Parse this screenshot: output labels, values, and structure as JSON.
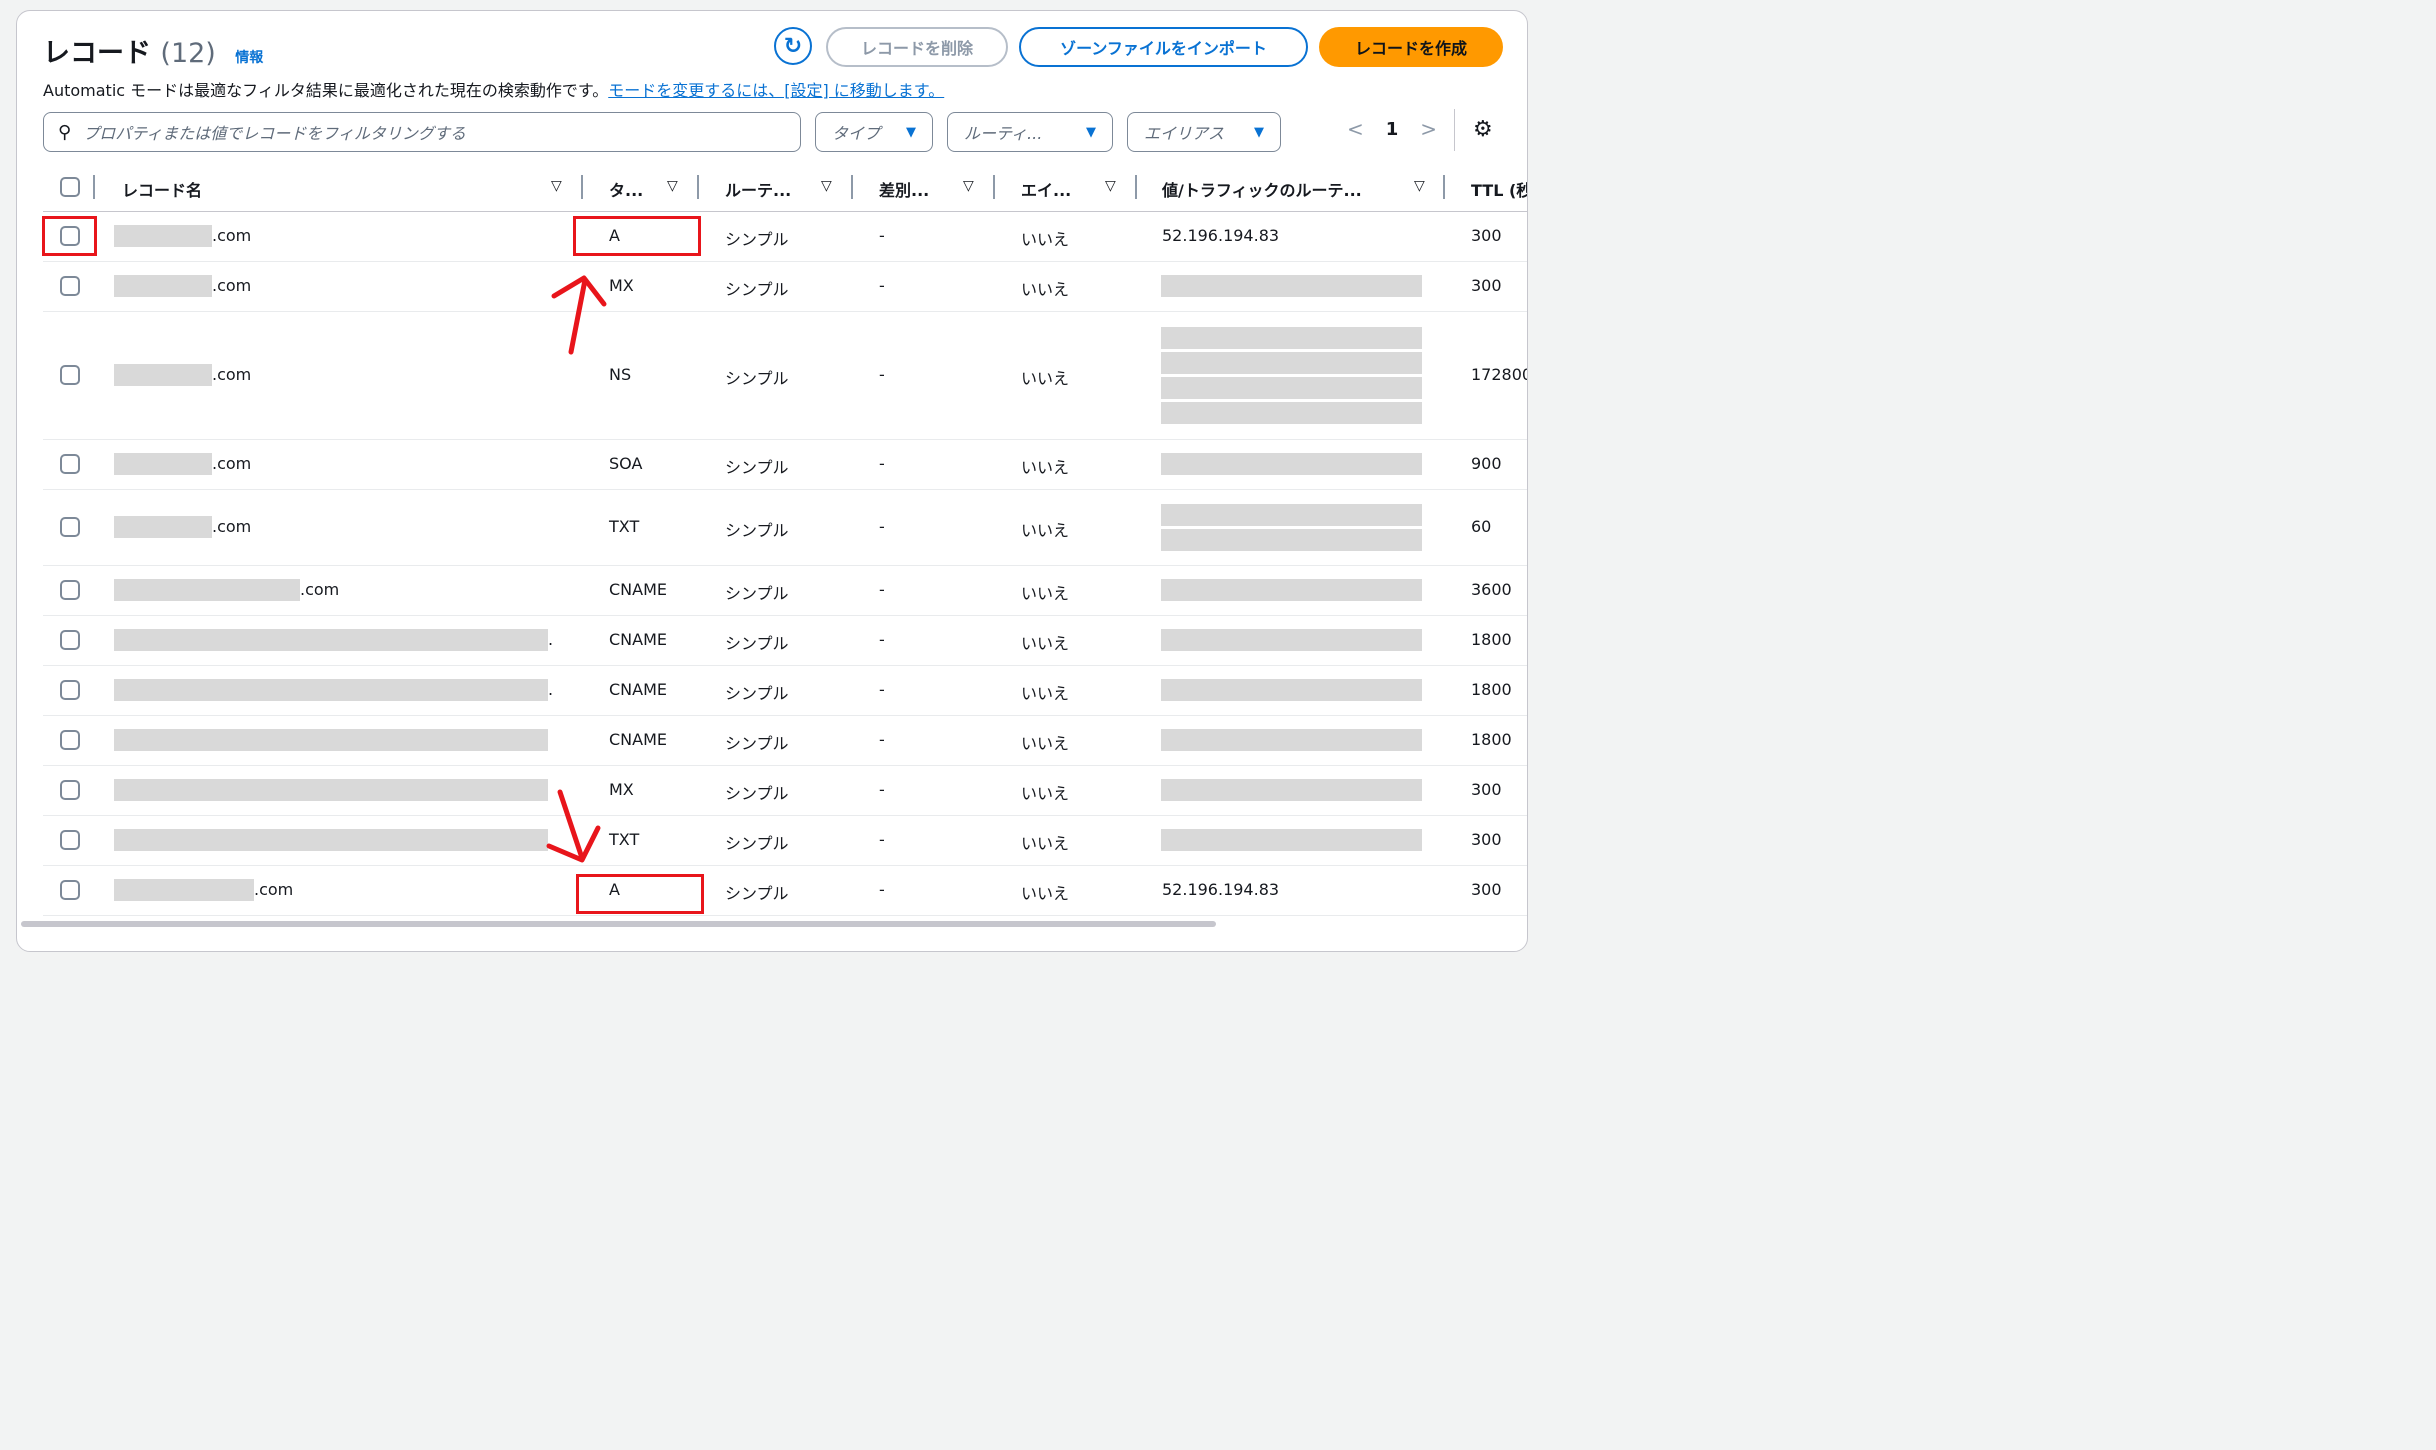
{
  "header": {
    "title": "レコード",
    "count": "(12)",
    "info_link": "情報",
    "description": "Automatic モードは最適なフィルタ結果に最適化された現在の検索動作です。",
    "description_link": "モードを変更するには、[設定] に移動します。",
    "delete_button": "レコードを削除",
    "import_button": "ゾーンファイルをインポート",
    "create_button": "レコードを作成"
  },
  "search": {
    "placeholder": "プロパティまたは値でレコードをフィルタリングする"
  },
  "filters": {
    "type": "タイプ",
    "routing": "ルーティ...",
    "alias": "エイリアス"
  },
  "pagination": {
    "prev": "<",
    "page": "1",
    "next": ">"
  },
  "columns": {
    "name": "レコード名",
    "type": "タ...",
    "routing": "ルーテ...",
    "diff": "差別...",
    "alias": "エイ...",
    "value": "値/トラフィックのルーテ...",
    "ttl": "TTL (秒"
  },
  "rows": [
    {
      "name_suffix": ".com",
      "type": "A",
      "routing": "シンプル",
      "diff": "-",
      "alias": "いいえ",
      "value": "52.196.194.83",
      "ttl": "300"
    },
    {
      "name_suffix": ".com",
      "type": "MX",
      "routing": "シンプル",
      "diff": "-",
      "alias": "いいえ",
      "value": "",
      "ttl": "300"
    },
    {
      "name_suffix": ".com",
      "type": "NS",
      "routing": "シンプル",
      "diff": "-",
      "alias": "いいえ",
      "value": "",
      "ttl": "172800"
    },
    {
      "name_suffix": ".com",
      "type": "SOA",
      "routing": "シンプル",
      "diff": "-",
      "alias": "いいえ",
      "value": "",
      "ttl": "900"
    },
    {
      "name_suffix": ".com",
      "type": "TXT",
      "routing": "シンプル",
      "diff": "-",
      "alias": "いいえ",
      "value": "",
      "ttl": "60"
    },
    {
      "name_suffix": ".com",
      "type": "CNAME",
      "routing": "シンプル",
      "diff": "-",
      "alias": "いいえ",
      "value": "",
      "ttl": "3600"
    },
    {
      "name_suffix": ".",
      "type": "CNAME",
      "routing": "シンプル",
      "diff": "-",
      "alias": "いいえ",
      "value": "",
      "ttl": "1800"
    },
    {
      "name_suffix": ".",
      "type": "CNAME",
      "routing": "シンプル",
      "diff": "-",
      "alias": "いいえ",
      "value": "",
      "ttl": "1800"
    },
    {
      "name_suffix": "",
      "type": "CNAME",
      "routing": "シンプル",
      "diff": "-",
      "alias": "いいえ",
      "value": "",
      "ttl": "1800"
    },
    {
      "name_suffix": "",
      "type": "MX",
      "routing": "シンプル",
      "diff": "-",
      "alias": "いいえ",
      "value": "",
      "ttl": "300"
    },
    {
      "name_suffix": "",
      "type": "TXT",
      "routing": "シンプル",
      "diff": "-",
      "alias": "いいえ",
      "value": "",
      "ttl": "300"
    },
    {
      "name_suffix": ".com",
      "type": "A",
      "routing": "シンプル",
      "diff": "-",
      "alias": "いいえ",
      "value": "52.196.194.83",
      "ttl": "300"
    }
  ],
  "colors": {
    "accent": "#0972d3",
    "primary_button": "#ff9900",
    "annotation": "#e8151b",
    "redaction": "#d9d9d9"
  },
  "icons": {
    "refresh": "refresh-icon",
    "search": "search-icon",
    "settings": "gear-icon",
    "sort": "sort-down-icon"
  }
}
